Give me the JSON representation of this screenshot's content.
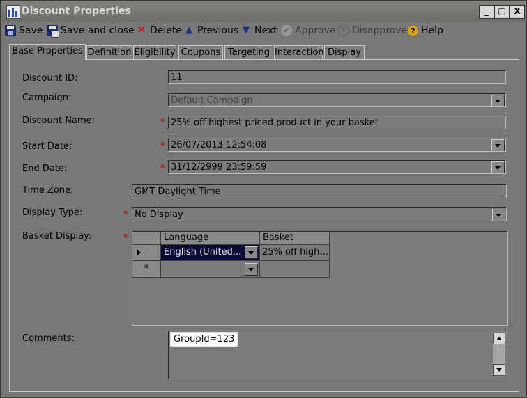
{
  "window": {
    "title": "Discount Properties",
    "controls": {
      "minimize": "_",
      "maximize": "□",
      "close": "X"
    }
  },
  "toolbar": {
    "save": "Save",
    "save_close": "Save and close",
    "delete": "Delete",
    "previous": "Previous",
    "next": "Next",
    "approve": "Approve",
    "disapprove": "Disapprove",
    "help": "Help"
  },
  "tabs": [
    "Base Properties",
    "Definition",
    "Eligibility",
    "Coupons",
    "Targeting",
    "Interaction",
    "Display"
  ],
  "form": {
    "discount_id": {
      "label": "Discount ID:",
      "value": "11"
    },
    "campaign": {
      "label": "Campaign:",
      "value": "Default Campaign"
    },
    "discount_name": {
      "label": "Discount Name:",
      "value": "25% off highest priced product in your basket"
    },
    "start_date": {
      "label": "Start Date:",
      "value": "26/07/2013 12:54:08"
    },
    "end_date": {
      "label": "End Date:",
      "value": "31/12/2999 23:59:59"
    },
    "time_zone": {
      "label": "Time Zone:",
      "value": "GMT Daylight Time"
    },
    "display_type": {
      "label": "Display Type:",
      "value": "No Display"
    },
    "basket_display": {
      "label": "Basket Display:",
      "columns": [
        "Language",
        "Basket"
      ],
      "rows": [
        [
          "English (United...",
          "25% off high..."
        ]
      ],
      "new_row_marker": "*"
    },
    "comments": {
      "label": "Comments:",
      "value": "GroupId=123"
    },
    "required_mark": "*"
  },
  "colors": {
    "accent_selected": "#0a0a3a",
    "required": "#b00000"
  }
}
